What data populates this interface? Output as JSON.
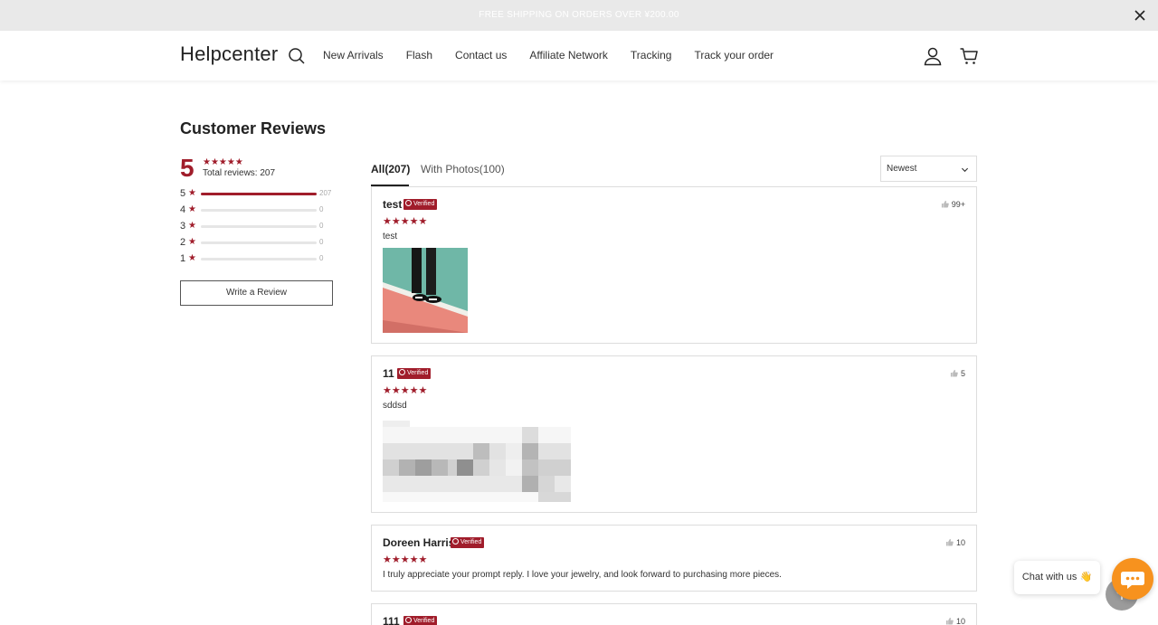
{
  "announcement": {
    "text": "FREE SHIPPING ON ORDERS OVER ¥200.00"
  },
  "header": {
    "logo": "Helpcenter",
    "nav": [
      "New Arrivals",
      "Flash",
      "Contact us",
      "Affiliate Network",
      "Tracking",
      "Track your order"
    ]
  },
  "page": {
    "title": "Customer Reviews"
  },
  "summary": {
    "score": "5",
    "stars": "★★★★★",
    "total_label": "Total reviews: 207",
    "bars": [
      {
        "rating": "5",
        "count": "207",
        "fraction": 1.0
      },
      {
        "rating": "4",
        "count": "0",
        "fraction": 0
      },
      {
        "rating": "3",
        "count": "0",
        "fraction": 0
      },
      {
        "rating": "2",
        "count": "0",
        "fraction": 0
      },
      {
        "rating": "1",
        "count": "0",
        "fraction": 0
      }
    ],
    "write_button": "Write a Review"
  },
  "tabs": {
    "all": "All(207)",
    "photos": "With Photos(100)"
  },
  "sort": {
    "value": "Newest"
  },
  "reviews": [
    {
      "name": "test",
      "verified": "Verified",
      "stars": "★★★★★",
      "text": "test",
      "likes": "99+"
    },
    {
      "name": "11",
      "verified": "Verified",
      "stars": "★★★★★",
      "text": "sddsd",
      "likes": "5"
    },
    {
      "name": "Doreen Harris",
      "verified": "Verified",
      "stars": "★★★★★",
      "text": "I truly appreciate your prompt reply. I love your jewelry, and look forward to purchasing more pieces.",
      "likes": "10"
    },
    {
      "name": "111",
      "verified": "Verified",
      "likes": "10"
    }
  ],
  "chat": {
    "label": "Chat with us 👋"
  },
  "colors": {
    "accent": "#a01d2b",
    "chat": "#f7921e"
  },
  "icons": [
    "close-icon",
    "search-icon",
    "user-icon",
    "cart-icon",
    "chevron-down-icon",
    "thumbs-up-icon",
    "chat-icon",
    "arrow-up-icon"
  ]
}
